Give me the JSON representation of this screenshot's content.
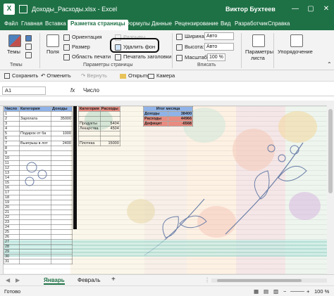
{
  "window": {
    "app_icon": "X",
    "title": "Доходы_Расходы.xlsx - Excel",
    "user": "Виктор Бухтеев",
    "controls": [
      "—",
      "▢",
      "✕"
    ]
  },
  "menu": {
    "tabs": [
      "Файл",
      "Главная",
      "Вставка",
      "Разметка страницы",
      "Формулы",
      "Данные",
      "Рецензирование",
      "Вид",
      "Разработчик",
      "Справка"
    ],
    "active_tab": "Разметка страницы"
  },
  "ribbon": {
    "themes_label": "Темы",
    "margins_label": "Поля",
    "orientation_label": "Ориентация",
    "size_label": "Размер",
    "print_area_label": "Область печати",
    "breaks_label": "Разрывы",
    "delete_bg_label": "Удалить фон",
    "print_titles_label": "Печатать заголовки",
    "width_label": "Ширина:",
    "width_value": "Авто",
    "height_label": "Высота:",
    "height_value": "Авто",
    "scale_label": "Масштаб:",
    "scale_value": "100 %",
    "sheet_params_line1": "Параметры",
    "sheet_params_line2": "листа",
    "arrange_label": "Упорядочение",
    "group_themes": "Темы",
    "group_page_setup": "Параметры страницы",
    "group_fit": "Вписать"
  },
  "qat": {
    "save": "Сохранить",
    "undo": "Отменить",
    "redo": "Вернуть",
    "open": "Открыть",
    "camera": "Камера"
  },
  "formula_bar": {
    "name_box": "A1",
    "fx": "fx",
    "content": "Число"
  },
  "table_left": {
    "headers": [
      "Число",
      "Категория",
      "Доходы"
    ],
    "rows": [
      [
        "1",
        "",
        ""
      ],
      [
        "2",
        "Зарплата",
        "35000"
      ],
      [
        "3",
        "",
        ""
      ],
      [
        "4",
        "",
        ""
      ],
      [
        "5",
        "Подарок от ба",
        "1000"
      ],
      [
        "6",
        "",
        ""
      ],
      [
        "7",
        "Выигрыш в лот",
        "2400"
      ],
      [
        "8",
        "",
        ""
      ],
      [
        "9",
        "",
        ""
      ],
      [
        "10",
        "",
        ""
      ],
      [
        "11",
        "",
        ""
      ],
      [
        "12",
        "",
        ""
      ],
      [
        "13",
        "",
        ""
      ],
      [
        "14",
        "",
        ""
      ],
      [
        "15",
        "",
        ""
      ],
      [
        "16",
        "",
        ""
      ],
      [
        "17",
        "",
        ""
      ],
      [
        "18",
        "",
        ""
      ],
      [
        "19",
        "",
        ""
      ],
      [
        "20",
        "",
        ""
      ],
      [
        "21",
        "",
        ""
      ],
      [
        "22",
        "",
        ""
      ],
      [
        "23",
        "",
        ""
      ],
      [
        "24",
        "",
        ""
      ],
      [
        "25",
        "",
        ""
      ],
      [
        "26",
        "",
        ""
      ],
      [
        "27",
        "",
        ""
      ],
      [
        "28",
        "",
        ""
      ],
      [
        "29",
        "",
        ""
      ],
      [
        "30",
        "",
        ""
      ],
      [
        "31",
        "",
        ""
      ]
    ]
  },
  "table_mid": {
    "headers": [
      "Категория",
      "Расходы"
    ],
    "rows": [
      [
        "",
        ""
      ],
      [
        "",
        ""
      ],
      [
        "Продукты",
        "5404"
      ],
      [
        "Лекарства",
        "4504"
      ],
      [
        "",
        ""
      ],
      [
        "",
        ""
      ],
      [
        "Плотека",
        "15000"
      ]
    ]
  },
  "table_summary": {
    "header": "Итог месяца",
    "rows": [
      [
        "Доходы",
        "38400"
      ],
      [
        "Расходы",
        "44966"
      ],
      [
        "Дефицит",
        "-6568"
      ]
    ]
  },
  "sheets": {
    "tabs": [
      "Январь",
      "Февраль"
    ],
    "active": "Январь",
    "add": "+",
    "menu": "⋮"
  },
  "status": {
    "ready": "Готово",
    "zoom": "100 %"
  },
  "colors": {
    "excel_green": "#1e7145",
    "header_blue": "#8fb3e8",
    "header_red": "#e98b80"
  }
}
